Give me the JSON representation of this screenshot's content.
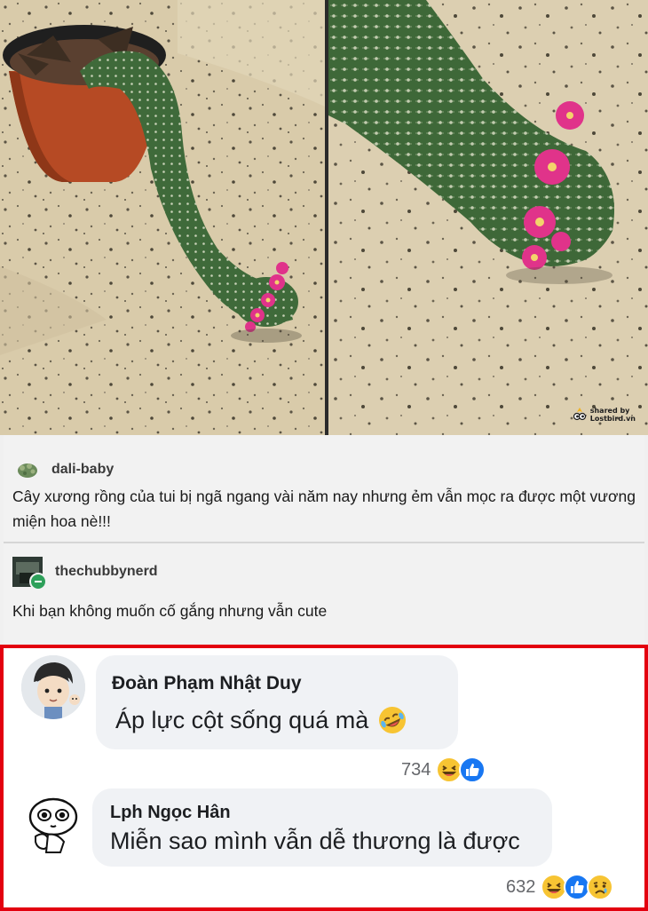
{
  "watermark": {
    "line1": "shared by",
    "line2": "Lostbird.vn"
  },
  "tumblr_posts": [
    {
      "username": "dali-baby",
      "text": "Cây xương rồng của tui bị ngã ngang vài năm nay nhưng ẻm vẫn mọc ra được một vương miện hoa nè!!!"
    },
    {
      "username": "thechubbynerd",
      "text": "Khi bạn không muốn cố gắng nhưng vẫn cute"
    }
  ],
  "comments": [
    {
      "author": "Đoàn Phạm Nhật Duy",
      "text": "Áp lực cột sống quá mà",
      "emoji": "rolling-on-floor-laughing",
      "reaction_count": "734",
      "reactions": [
        "haha",
        "like"
      ]
    },
    {
      "author": "Lph Ngọc Hân",
      "text": "Miễn sao mình vẫn dễ thương là được",
      "reaction_count": "632",
      "reactions": [
        "haha",
        "like",
        "sad"
      ]
    }
  ],
  "colors": {
    "highlight_border": "#e3000f",
    "bubble": "#f0f2f5",
    "like_blue": "#1877f2",
    "haha_yellow": "#f7c433",
    "flower_pink": "#e0338a"
  }
}
